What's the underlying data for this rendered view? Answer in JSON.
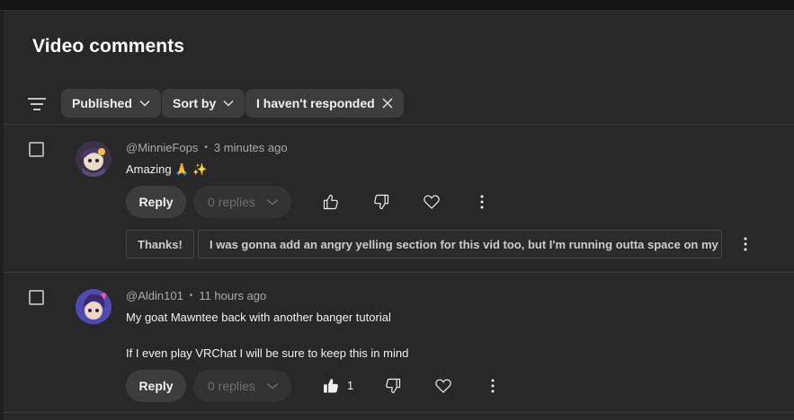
{
  "header": {
    "title": "Video comments"
  },
  "filters": {
    "icon": "filter-icon",
    "chips": [
      {
        "label": "Published",
        "icon": "chevron-down-icon"
      },
      {
        "label": "Sort by",
        "icon": "chevron-down-icon"
      },
      {
        "label": "I haven't responded",
        "icon": "close-icon"
      }
    ]
  },
  "comments": [
    {
      "author": "@MinnieFops",
      "time": "3 minutes ago",
      "text_lines": [
        "Amazing 🙏 ✨"
      ],
      "reply_label": "Reply",
      "replies_label": "0 replies",
      "like_count": "",
      "liked": false,
      "quick_replies": [
        "Thanks!",
        "I was gonna add an angry yelling section for this vid too, but I'm running outta space on my drive"
      ]
    },
    {
      "author": "@Aldin101",
      "time": "11 hours ago",
      "text_lines": [
        "My goat Mawntee back with another banger tutorial",
        "If I even play VRChat I will be sure to keep this in mind"
      ],
      "reply_label": "Reply",
      "replies_label": "0 replies",
      "like_count": "1",
      "liked": true,
      "quick_replies": []
    }
  ],
  "colors": {
    "background": "#282828",
    "chip_bg": "#3d3d3d",
    "text_primary": "#f1f1f1",
    "text_secondary": "#aaaaaa"
  }
}
